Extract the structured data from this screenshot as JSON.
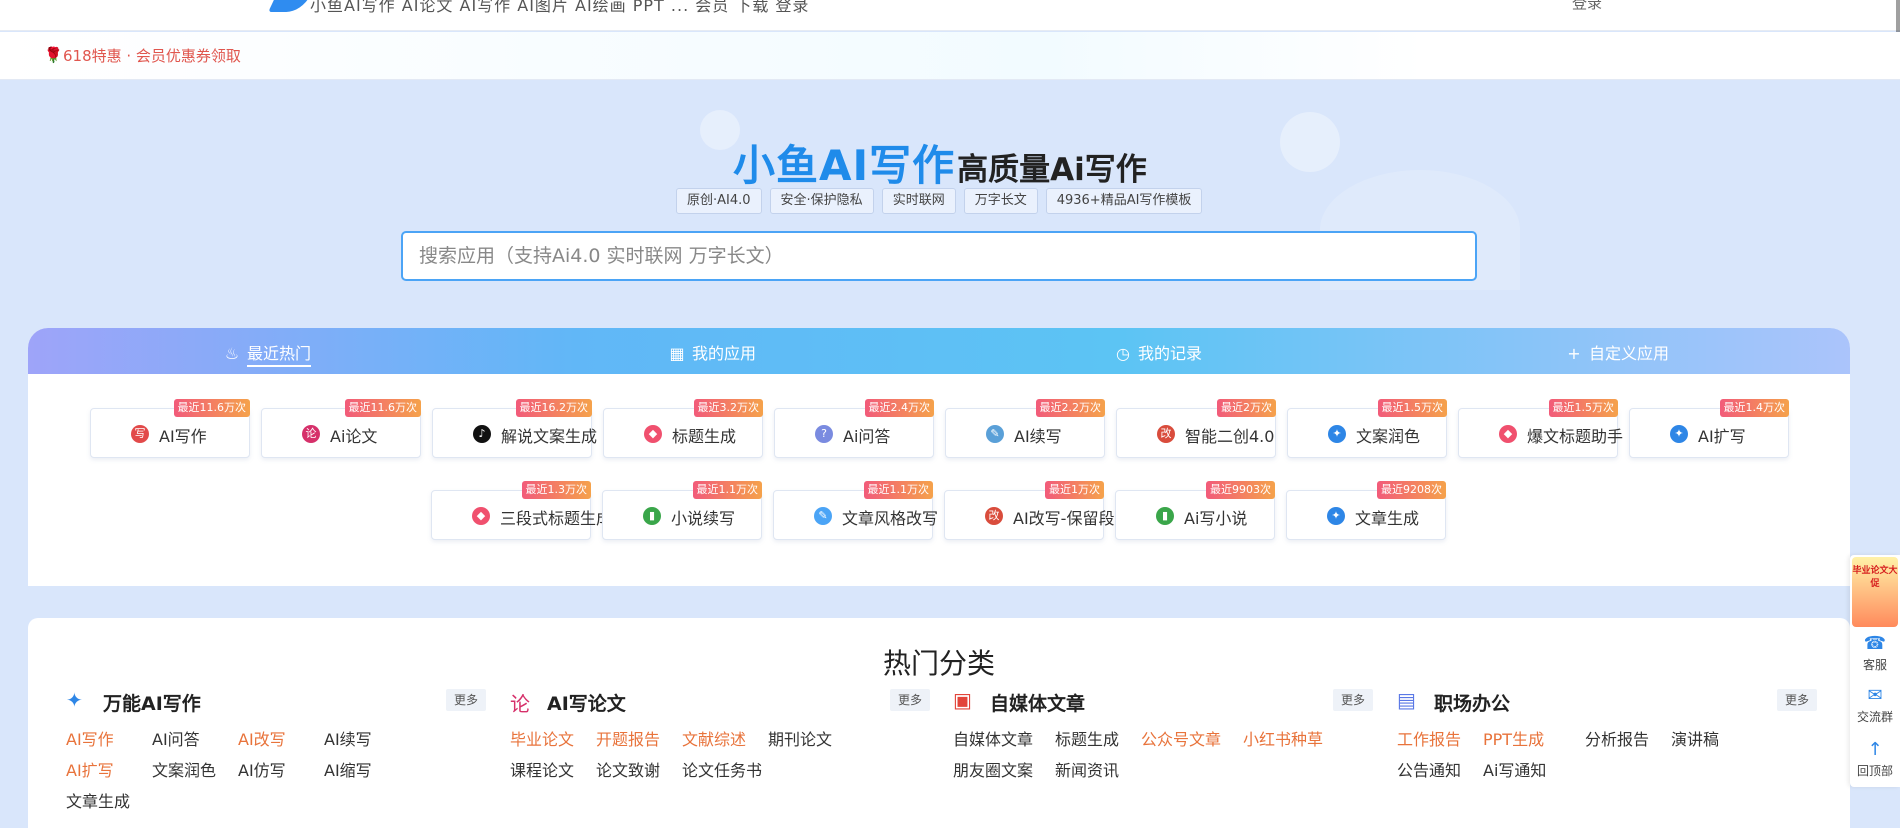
{
  "topbar": {
    "nav_text": "小鱼AI写作  AI论文  AI写作  AI图片  AI绘画  PPT  ...  会员  下载  登录",
    "right_text": "登录"
  },
  "promo": {
    "flag_icon": "rose-icon",
    "text": "618特惠 · 会员优惠券领取"
  },
  "hero": {
    "brand": "小鱼AI写作",
    "subtitle": "高质量Ai写作",
    "tags": [
      "原创·AI4.0",
      "安全·保护隐私",
      "实时联网",
      "万字长文",
      "4936+精品AI写作模板"
    ],
    "search_placeholder": "搜索应用（支持Ai4.0 实时联网 万字长文）"
  },
  "tabs": [
    {
      "label": "最近热门",
      "icon": "flame-icon",
      "active": true
    },
    {
      "label": "我的应用",
      "icon": "grid-icon",
      "active": false
    },
    {
      "label": "我的记录",
      "icon": "clock-icon",
      "active": false
    },
    {
      "label": "自定义应用",
      "icon": "plus-icon",
      "active": false
    }
  ],
  "apps": [
    {
      "label": "AI写作",
      "badge": "最近11.6万次",
      "icon": "pen-icon",
      "color": "#e24a4a"
    },
    {
      "label": "Ai论文",
      "badge": "最近11.6万次",
      "icon": "paper-icon",
      "color": "#d6306a"
    },
    {
      "label": "解说文案生成",
      "badge": "最近16.2万次",
      "icon": "tiktok-icon",
      "color": "#111111"
    },
    {
      "label": "标题生成",
      "badge": "最近3.2万次",
      "icon": "tag-icon",
      "color": "#f0506e"
    },
    {
      "label": "Ai问答",
      "badge": "最近2.4万次",
      "icon": "chat-icon",
      "color": "#7a8be0"
    },
    {
      "label": "AI续写",
      "badge": "最近2.2万次",
      "icon": "write-icon",
      "color": "#5aa0d8"
    },
    {
      "label": "智能二创4.0",
      "badge": "最近2万次",
      "icon": "rewrite-icon",
      "color": "#d94c3c"
    },
    {
      "label": "文案润色",
      "badge": "最近1.5万次",
      "icon": "ai-sparkle-icon",
      "color": "#2e86e6"
    },
    {
      "label": "爆文标题助手",
      "badge": "最近1.5万次",
      "icon": "tag-icon",
      "color": "#f0506e"
    },
    {
      "label": "AI扩写",
      "badge": "最近1.4万次",
      "icon": "ai-sparkle-icon",
      "color": "#2e86e6"
    },
    {
      "label": "三段式标题生成",
      "badge": "最近1.3万次",
      "icon": "tag-icon",
      "color": "#f0506e"
    },
    {
      "label": "小说续写",
      "badge": "最近1.1万次",
      "icon": "book-icon",
      "color": "#3aa64a"
    },
    {
      "label": "文章风格改写",
      "badge": "最近1.1万次",
      "icon": "edit-icon",
      "color": "#4ba4f6"
    },
    {
      "label": "AI改写-保留段落",
      "badge": "最近1万次",
      "icon": "rewrite-icon",
      "color": "#d94c3c"
    },
    {
      "label": "Ai写小说",
      "badge": "最近9903次",
      "icon": "book-icon",
      "color": "#3aa64a"
    },
    {
      "label": "文章生成",
      "badge": "最近9208次",
      "icon": "ai-sparkle-icon",
      "color": "#2e86e6"
    }
  ],
  "categories_title": "热门分类",
  "categories": [
    {
      "title": "万能AI写作",
      "icon": "ai-sparkle-icon",
      "more": "更多",
      "links": [
        {
          "text": "AI写作",
          "hl": true
        },
        {
          "text": "AI问答",
          "hl": false
        },
        {
          "text": "AI改写",
          "hl": true
        },
        {
          "text": "AI续写",
          "hl": false
        },
        {
          "text": "AI扩写",
          "hl": true
        },
        {
          "text": "文案润色",
          "hl": false
        },
        {
          "text": "AI仿写",
          "hl": false
        },
        {
          "text": "AI缩写",
          "hl": false
        },
        {
          "text": "文章生成",
          "hl": false
        }
      ]
    },
    {
      "title": "AI写论文",
      "icon": "paper-icon",
      "more": "更多",
      "links": [
        {
          "text": "毕业论文",
          "hl": true
        },
        {
          "text": "开题报告",
          "hl": true
        },
        {
          "text": "文献综述",
          "hl": true
        },
        {
          "text": "期刊论文",
          "hl": false
        },
        {
          "text": "课程论文",
          "hl": false
        },
        {
          "text": "论文致谢",
          "hl": false
        },
        {
          "text": "论文任务书",
          "hl": false
        }
      ]
    },
    {
      "title": "自媒体文章",
      "icon": "media-icon",
      "more": "更多",
      "links": [
        {
          "text": "自媒体文章",
          "hl": false
        },
        {
          "text": "标题生成",
          "hl": false
        },
        {
          "text": "公众号文章",
          "hl": true
        },
        {
          "text": "小红书种草",
          "hl": true
        },
        {
          "text": "朋友圈文案",
          "hl": false
        },
        {
          "text": "新闻资讯",
          "hl": false
        }
      ]
    },
    {
      "title": "职场办公",
      "icon": "briefcase-icon",
      "more": "更多",
      "links": [
        {
          "text": "工作报告",
          "hl": true
        },
        {
          "text": "PPT生成",
          "hl": true
        },
        {
          "text": "分析报告",
          "hl": false
        },
        {
          "text": "演讲稿",
          "hl": false
        },
        {
          "text": "公告通知",
          "hl": false
        },
        {
          "text": "Ai写通知",
          "hl": false
        }
      ]
    }
  ],
  "sidebar": {
    "promo_text": "毕业论文大促",
    "items": [
      {
        "label": "客服",
        "icon": "headset-icon"
      },
      {
        "label": "交流群",
        "icon": "wechat-icon"
      },
      {
        "label": "回顶部",
        "icon": "arrow-up-icon"
      }
    ]
  }
}
